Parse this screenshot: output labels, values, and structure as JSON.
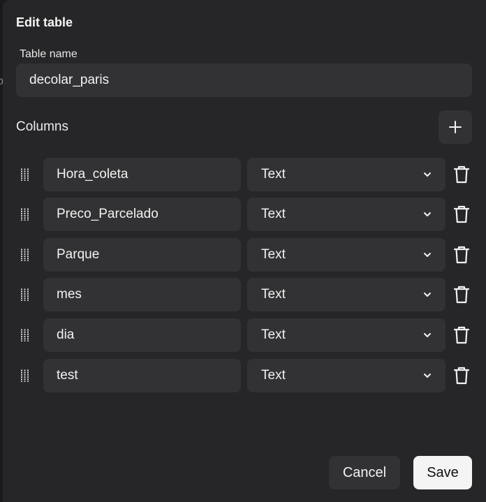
{
  "dialog": {
    "title": "Edit table",
    "background_color": "#262628",
    "field_background_color": "#323234"
  },
  "background": {
    "edge_letter": "o"
  },
  "table_name": {
    "label": "Table name",
    "value": "decolar_paris"
  },
  "columns_section": {
    "label": "Columns",
    "add_icon": "plus-icon"
  },
  "columns": [
    {
      "name": "Hora_coleta",
      "type": "Text"
    },
    {
      "name": "Preco_Parcelado",
      "type": "Text"
    },
    {
      "name": "Parque",
      "type": "Text"
    },
    {
      "name": "mes",
      "type": "Text"
    },
    {
      "name": "dia",
      "type": "Text"
    },
    {
      "name": "test",
      "type": "Text"
    }
  ],
  "row_icons": {
    "drag": "drag-handle-icon",
    "dropdown": "chevron-down-icon",
    "delete": "trash-icon"
  },
  "footer": {
    "cancel_label": "Cancel",
    "save_label": "Save",
    "save_button_color": "#f4f4f4"
  }
}
